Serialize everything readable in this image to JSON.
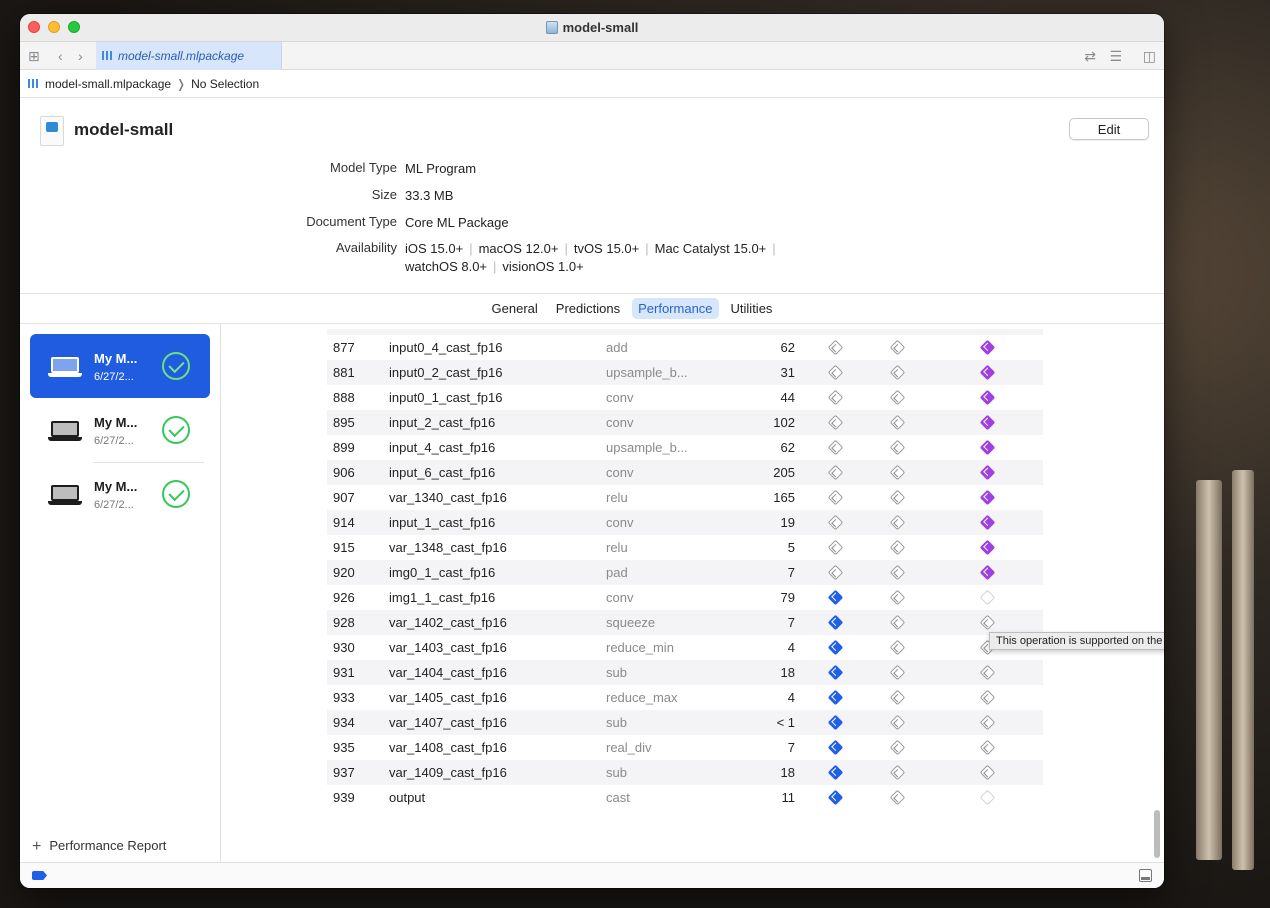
{
  "window": {
    "title": "model-small"
  },
  "tabbar": {
    "doc_tab": "model-small.mlpackage"
  },
  "breadcrumb": {
    "file": "model-small.mlpackage",
    "selection": "No Selection"
  },
  "header": {
    "title": "model-small",
    "edit_label": "Edit",
    "info": {
      "model_type_label": "Model Type",
      "model_type": "ML Program",
      "size_label": "Size",
      "size": "33.3 MB",
      "doc_type_label": "Document Type",
      "doc_type": "Core ML Package",
      "availability_label": "Availability",
      "availability": [
        "iOS 15.0+",
        "macOS 12.0+",
        "tvOS 15.0+",
        "Mac Catalyst 15.0+",
        "watchOS 8.0+",
        "visionOS 1.0+"
      ]
    }
  },
  "tabs": [
    "General",
    "Predictions",
    "Performance",
    "Utilities"
  ],
  "active_tab": "Performance",
  "sidebar": {
    "devices": [
      {
        "name": "My M...",
        "date": "6/27/2...",
        "selected": true
      },
      {
        "name": "My M...",
        "date": "6/27/2...",
        "selected": false
      },
      {
        "name": "My M...",
        "date": "6/27/2...",
        "selected": false
      }
    ],
    "add_label": "Performance Report"
  },
  "table": {
    "rows": [
      {
        "id": "877",
        "name": "input0_4_cast_fp16",
        "op": "add",
        "time": "62",
        "cpu": "unsup",
        "gpu": "unsup",
        "ne": "ne"
      },
      {
        "id": "881",
        "name": "input0_2_cast_fp16",
        "op": "upsample_b...",
        "time": "31",
        "cpu": "unsup",
        "gpu": "unsup",
        "ne": "ne"
      },
      {
        "id": "888",
        "name": "input0_1_cast_fp16",
        "op": "conv",
        "time": "44",
        "cpu": "unsup",
        "gpu": "unsup",
        "ne": "ne"
      },
      {
        "id": "895",
        "name": "input_2_cast_fp16",
        "op": "conv",
        "time": "102",
        "cpu": "unsup",
        "gpu": "unsup",
        "ne": "ne"
      },
      {
        "id": "899",
        "name": "input_4_cast_fp16",
        "op": "upsample_b...",
        "time": "62",
        "cpu": "unsup",
        "gpu": "unsup",
        "ne": "ne"
      },
      {
        "id": "906",
        "name": "input_6_cast_fp16",
        "op": "conv",
        "time": "205",
        "cpu": "unsup",
        "gpu": "unsup",
        "ne": "ne"
      },
      {
        "id": "907",
        "name": "var_1340_cast_fp16",
        "op": "relu",
        "time": "165",
        "cpu": "unsup",
        "gpu": "unsup",
        "ne": "ne"
      },
      {
        "id": "914",
        "name": "input_1_cast_fp16",
        "op": "conv",
        "time": "19",
        "cpu": "unsup",
        "gpu": "unsup",
        "ne": "ne"
      },
      {
        "id": "915",
        "name": "var_1348_cast_fp16",
        "op": "relu",
        "time": "5",
        "cpu": "unsup",
        "gpu": "unsup",
        "ne": "ne"
      },
      {
        "id": "920",
        "name": "img0_1_cast_fp16",
        "op": "pad",
        "time": "7",
        "cpu": "unsup",
        "gpu": "unsup",
        "ne": "ne"
      },
      {
        "id": "926",
        "name": "img1_1_cast_fp16",
        "op": "conv",
        "time": "79",
        "cpu": "cpu",
        "gpu": "unsup",
        "ne": "empty"
      },
      {
        "id": "928",
        "name": "var_1402_cast_fp16",
        "op": "squeeze",
        "time": "7",
        "cpu": "cpu",
        "gpu": "unsup",
        "ne": "unsup"
      },
      {
        "id": "930",
        "name": "var_1403_cast_fp16",
        "op": "reduce_min",
        "time": "4",
        "cpu": "cpu",
        "gpu": "unsup",
        "ne": "unsup"
      },
      {
        "id": "931",
        "name": "var_1404_cast_fp16",
        "op": "sub",
        "time": "18",
        "cpu": "cpu",
        "gpu": "unsup",
        "ne": "unsup"
      },
      {
        "id": "933",
        "name": "var_1405_cast_fp16",
        "op": "reduce_max",
        "time": "4",
        "cpu": "cpu",
        "gpu": "unsup",
        "ne": "unsup"
      },
      {
        "id": "934",
        "name": "var_1407_cast_fp16",
        "op": "sub",
        "time": "< 1",
        "cpu": "cpu",
        "gpu": "unsup",
        "ne": "unsup"
      },
      {
        "id": "935",
        "name": "var_1408_cast_fp16",
        "op": "real_div",
        "time": "7",
        "cpu": "cpu",
        "gpu": "unsup",
        "ne": "unsup"
      },
      {
        "id": "937",
        "name": "var_1409_cast_fp16",
        "op": "sub",
        "time": "18",
        "cpu": "cpu",
        "gpu": "unsup",
        "ne": "unsup"
      },
      {
        "id": "939",
        "name": "output",
        "op": "cast",
        "time": "11",
        "cpu": "cpu",
        "gpu": "unsup",
        "ne": "empty"
      }
    ]
  },
  "tooltip": "This operation is supported on the Neural Engine",
  "colors": {
    "accent": "#1f5ce0",
    "neural_engine": "#a040e0",
    "cpu": "#2060e8",
    "success": "#34c759"
  }
}
